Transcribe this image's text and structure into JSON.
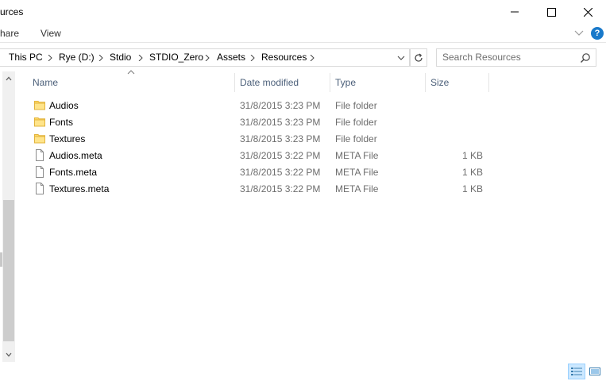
{
  "window": {
    "title": "urces"
  },
  "ribbon": {
    "tabs": [
      "hare",
      "View"
    ]
  },
  "address": {
    "crumbs": [
      "This PC",
      "Rye (D:)",
      "Stdio",
      "STDIO_Zero",
      "Assets",
      "Resources"
    ]
  },
  "search": {
    "placeholder": "Search Resources"
  },
  "columns": {
    "name": "Name",
    "date": "Date modified",
    "type": "Type",
    "size": "Size"
  },
  "files": [
    {
      "name": "Audios",
      "date": "31/8/2015 3:23 PM",
      "type": "File folder",
      "size": "",
      "icon": "folder-icon"
    },
    {
      "name": "Fonts",
      "date": "31/8/2015 3:23 PM",
      "type": "File folder",
      "size": "",
      "icon": "folder-icon"
    },
    {
      "name": "Textures",
      "date": "31/8/2015 3:23 PM",
      "type": "File folder",
      "size": "",
      "icon": "folder-icon"
    },
    {
      "name": "Audios.meta",
      "date": "31/8/2015 3:22 PM",
      "type": "META File",
      "size": "1 KB",
      "icon": "file-icon"
    },
    {
      "name": "Fonts.meta",
      "date": "31/8/2015 3:22 PM",
      "type": "META File",
      "size": "1 KB",
      "icon": "file-icon"
    },
    {
      "name": "Textures.meta",
      "date": "31/8/2015 3:22 PM",
      "type": "META File",
      "size": "1 KB",
      "icon": "file-icon"
    }
  ],
  "colors": {
    "folder": "#ffd866",
    "accent": "#1979ca",
    "header_text": "#4c607a"
  }
}
